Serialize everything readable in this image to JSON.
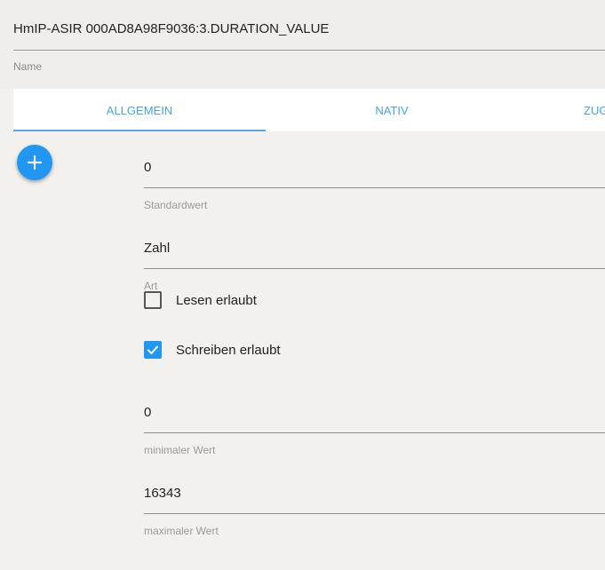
{
  "header": {
    "name_value": "HmIP-ASIR 000AD8A98F9036:3.DURATION_VALUE",
    "name_label": "Name"
  },
  "tabs": [
    {
      "label": "ALLGEMEIN",
      "active": true
    },
    {
      "label": "NATIV",
      "active": false
    },
    {
      "label": "ZUG",
      "active": false
    }
  ],
  "fab": {
    "icon": "plus-icon"
  },
  "form": {
    "default_value": {
      "value": "0",
      "label": "Standardwert"
    },
    "type": {
      "value": "Zahl",
      "label": "Art"
    },
    "read_allowed": {
      "label": "Lesen erlaubt",
      "checked": false
    },
    "write_allowed": {
      "label": "Schreiben erlaubt",
      "checked": true
    },
    "min_value": {
      "value": "0",
      "label": "minimaler Wert"
    },
    "max_value": {
      "value": "16343",
      "label": "maximaler Wert"
    }
  },
  "colors": {
    "accent": "#2196f3",
    "tab_text": "#4aa3df",
    "background": "#f3f1ee"
  }
}
